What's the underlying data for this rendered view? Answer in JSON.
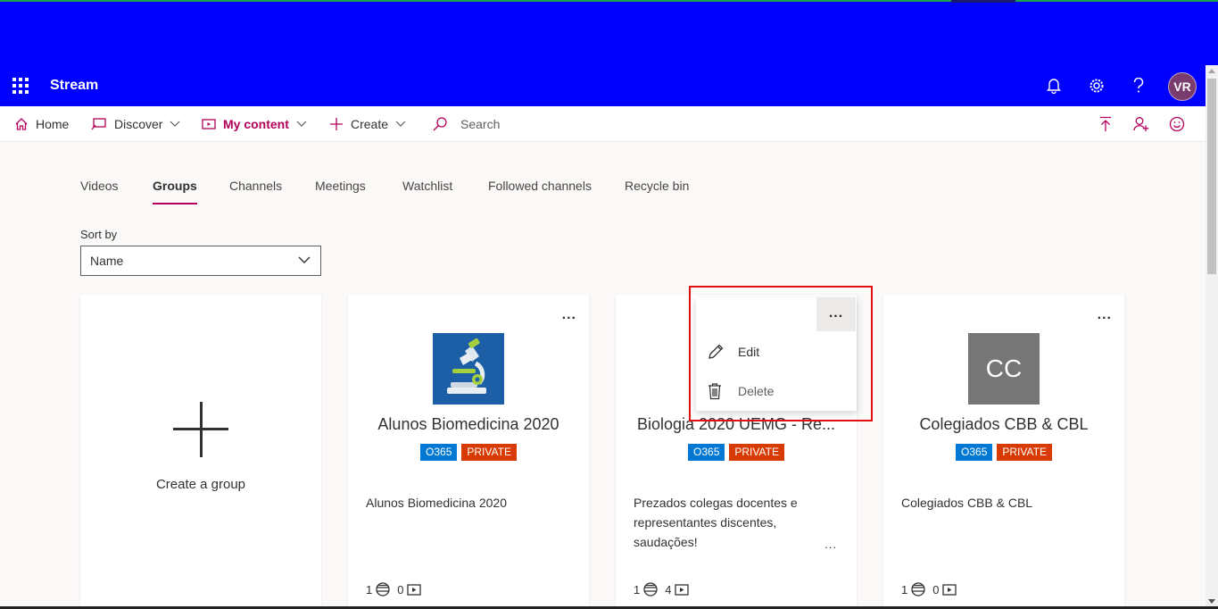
{
  "app": {
    "brand": "Stream",
    "avatar_initials": "VR"
  },
  "colors": {
    "suite_bar": "#0000ff",
    "accent": "#b4005a",
    "o365": "#0078d4",
    "private": "#d83b01"
  },
  "header_icons": [
    "bell-icon",
    "gear-icon",
    "help-icon"
  ],
  "nav": {
    "home": "Home",
    "discover": "Discover",
    "my_content": "My content",
    "create": "Create",
    "search_placeholder": "Search"
  },
  "tabs": [
    {
      "label": "Videos"
    },
    {
      "label": "Groups"
    },
    {
      "label": "Channels"
    },
    {
      "label": "Meetings"
    },
    {
      "label": "Watchlist"
    },
    {
      "label": "Followed channels"
    },
    {
      "label": "Recycle bin"
    }
  ],
  "sort": {
    "label": "Sort by",
    "value": "Name"
  },
  "create_group": {
    "label": "Create a group"
  },
  "groups": [
    {
      "title": "Alunos Biomedicina 2020",
      "badges": [
        "O365",
        "PRIVATE"
      ],
      "description": "Alunos Biomedicina 2020",
      "members": "1",
      "videos": "0",
      "more": "..."
    },
    {
      "title": "Biologia 2020 UEMG - Re...",
      "badges": [
        "O365",
        "PRIVATE"
      ],
      "description": "Prezados colegas docentes e representantes discentes, saudações!",
      "description_more": "...",
      "members": "1",
      "videos": "4",
      "more": "..."
    },
    {
      "title": "Colegiados CBB & CBL",
      "thumb_text": "CC",
      "badges": [
        "O365",
        "PRIVATE"
      ],
      "description": "Colegiados CBB & CBL",
      "members": "1",
      "videos": "0",
      "more": "..."
    }
  ],
  "context_menu": {
    "items": [
      {
        "label": "Edit",
        "icon": "pencil-icon"
      },
      {
        "label": "Delete",
        "icon": "trash-icon"
      }
    ]
  }
}
